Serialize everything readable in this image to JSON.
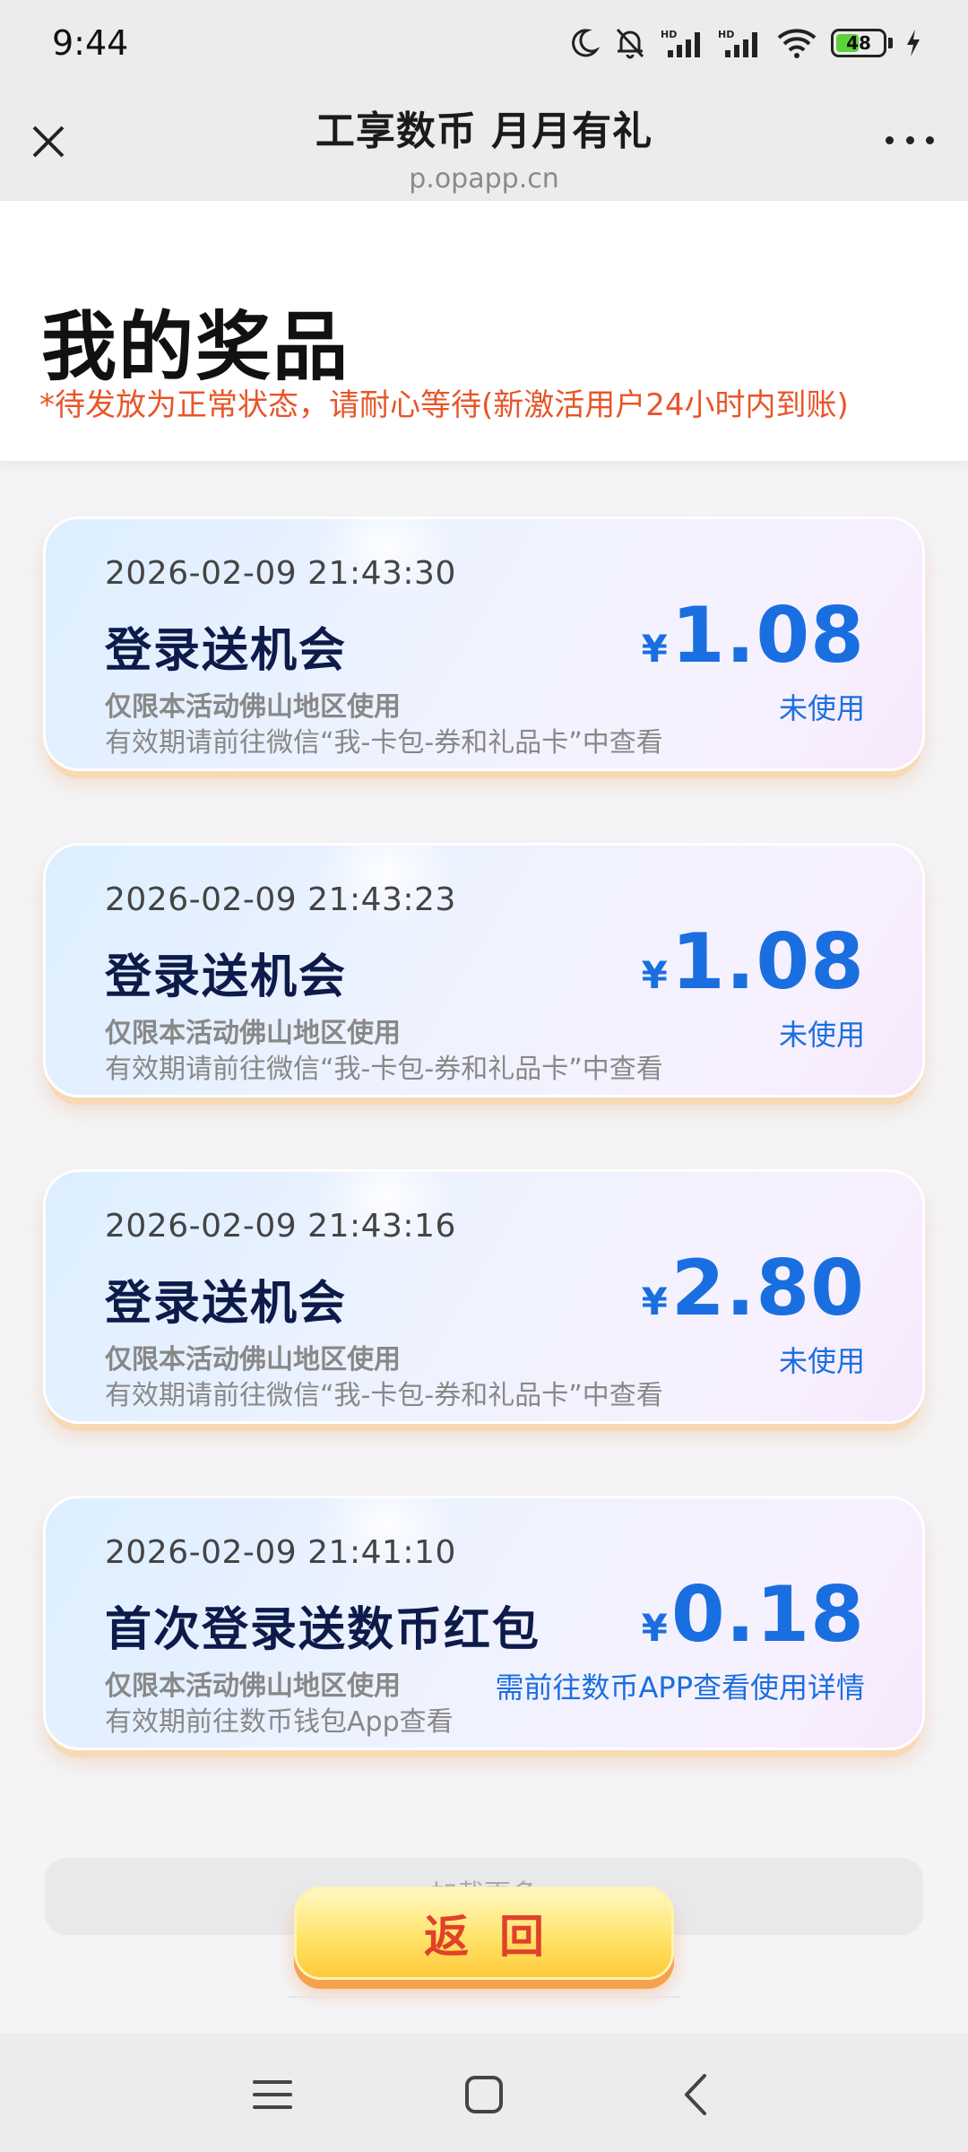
{
  "status_bar": {
    "time": "9:44",
    "icons": [
      "moon-icon",
      "bell-mute-icon",
      "signal-hd-icon",
      "signal-hd-icon",
      "wifi-icon"
    ],
    "battery": "48",
    "battery_level": 0.48
  },
  "title_bar": {
    "title": "工享数币 月月有礼",
    "url": "p.opapp.cn"
  },
  "header": {
    "title": "我的奖品",
    "note": "*待发放为正常状态，请耐心等待(新激活用户24小时内到账)"
  },
  "cards": [
    {
      "date": "2026-02-09 21:43:30",
      "name": "登录送机会",
      "line1": "仅限本活动佛山地区使用",
      "line2": "有效期请前往微信“我-卡包-券和礼品卡”中查看",
      "currency": "¥",
      "amount": "1.08",
      "status": "未使用"
    },
    {
      "date": "2026-02-09 21:43:23",
      "name": "登录送机会",
      "line1": "仅限本活动佛山地区使用",
      "line2": "有效期请前往微信“我-卡包-券和礼品卡”中查看",
      "currency": "¥",
      "amount": "1.08",
      "status": "未使用"
    },
    {
      "date": "2026-02-09 21:43:16",
      "name": "登录送机会",
      "line1": "仅限本活动佛山地区使用",
      "line2": "有效期请前往微信“我-卡包-券和礼品卡”中查看",
      "currency": "¥",
      "amount": "2.80",
      "status": "未使用"
    },
    {
      "date": "2026-02-09 21:41:10",
      "name": "首次登录送数币红包",
      "line1": "仅限本活动佛山地区使用",
      "line2": "有效期前往数币钱包App查看",
      "currency": "¥",
      "amount": "0.18",
      "status": "需前往数币APP查看使用详情"
    }
  ],
  "load_more": "加载更多",
  "back_button": "返回",
  "nav": {
    "icons": [
      "menu-icon",
      "home-square-icon",
      "back-arrow-icon"
    ]
  },
  "colors": {
    "accent_blue": "#1a6fe0",
    "note_orange": "#e8552a",
    "button_red": "#e0412a",
    "button_yellow": "#ffe46a"
  }
}
